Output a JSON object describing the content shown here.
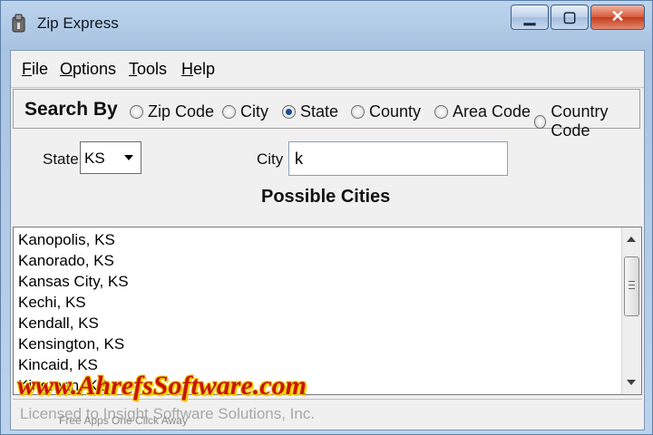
{
  "window": {
    "title": "Zip Express",
    "icon": "zip-express-app-icon"
  },
  "caption_buttons": {
    "minimize": "▁",
    "maximize": "▢",
    "close": "✕"
  },
  "menu": [
    {
      "label": "File",
      "underline": "F",
      "rest": "ile"
    },
    {
      "label": "Options",
      "underline": "O",
      "rest": "ptions"
    },
    {
      "label": "Tools",
      "underline": "T",
      "rest": "ools"
    },
    {
      "label": "Help",
      "underline": "H",
      "rest": "elp"
    }
  ],
  "search": {
    "title": "Search By",
    "options": [
      {
        "label": "Zip Code",
        "selected": false
      },
      {
        "label": "City",
        "selected": false
      },
      {
        "label": "State",
        "selected": true
      },
      {
        "label": "County",
        "selected": false
      },
      {
        "label": "Area Code",
        "selected": false
      },
      {
        "label": "Country Code",
        "selected": false
      }
    ]
  },
  "form": {
    "state_label": "State",
    "state_value": "KS",
    "city_label": "City",
    "city_value": "k"
  },
  "results": {
    "heading": "Possible Cities",
    "items": [
      "Kanopolis, KS",
      "Kanorado, KS",
      "Kansas City, KS",
      "Kechi, KS",
      "Kendall, KS",
      "Kensington, KS",
      "Kincaid, KS",
      "Kingman, KS"
    ]
  },
  "status": {
    "license": "Licensed to Insight Software Solutions, Inc.",
    "footer": "Free Apps One Click Away"
  },
  "watermark": "www.AhrefsSoftware.com",
  "colors": {
    "selected_radio": "#1d4c8e",
    "watermark": "#c8140c",
    "watermark_outline": "#f3d000"
  }
}
